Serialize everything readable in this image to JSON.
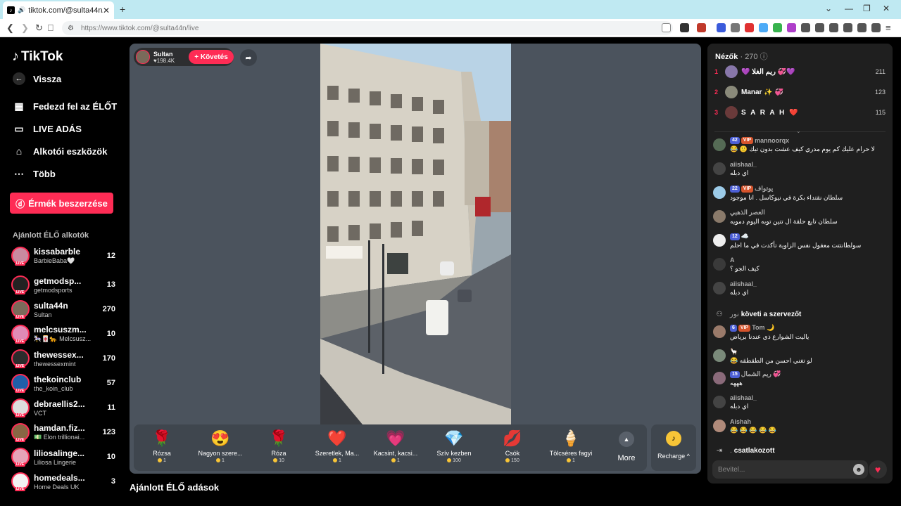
{
  "browser": {
    "tab_title": "tiktok.com/@sulta44n/live",
    "url": "https://www.tiktok.com/@sulta44n/live"
  },
  "sidebar": {
    "logo": "TikTok",
    "back": "Vissza",
    "nav": [
      {
        "label": "Fedezd fel az ÉLŐT",
        "icon": "calendar-live-icon"
      },
      {
        "label": "LIVE ADÁS",
        "icon": "camera-icon"
      },
      {
        "label": "Alkotói eszközök",
        "icon": "creator-tools-icon"
      },
      {
        "label": "Több",
        "icon": "more-dots-icon"
      }
    ],
    "coins_button": "Érmék beszerzése",
    "recommended_title": "Ajánlott ÉLŐ alkotók",
    "creators": [
      {
        "username": "kissabarble",
        "nickname": "BarbieBaba🤍",
        "count": "12"
      },
      {
        "username": "getmodsp...",
        "nickname": "getmodsports",
        "count": "13"
      },
      {
        "username": "sulta44n",
        "nickname": "Sultan",
        "count": "270"
      },
      {
        "username": "melcsuszm...",
        "nickname": "🎠🀄🐆 Melcsusz...",
        "count": "10"
      },
      {
        "username": "thewessex...",
        "nickname": "thewessexmint",
        "count": "170"
      },
      {
        "username": "thekoinclub",
        "nickname": "the_koin_club",
        "count": "57"
      },
      {
        "username": "debraellis2...",
        "nickname": "VCT",
        "count": "11"
      },
      {
        "username": "hamdan.fiz...",
        "nickname": "💵 Elon trillionai...",
        "count": "123"
      },
      {
        "username": "liliosalinge...",
        "nickname": "Liliosa Lingerie",
        "count": "10"
      },
      {
        "username": "homedeals...",
        "nickname": "Home Deals UK",
        "count": "3"
      }
    ]
  },
  "live": {
    "host_name": "Sultan",
    "host_likes": "198.4K",
    "follow_label": "+ Követés",
    "gifts": [
      {
        "name": "Rózsa",
        "price": "1",
        "icon": "🌹"
      },
      {
        "name": "Nagyon szere...",
        "price": "1",
        "icon": "😍"
      },
      {
        "name": "Róza",
        "price": "10",
        "icon": "🌹"
      },
      {
        "name": "Szeretlek, Ma...",
        "price": "1",
        "icon": "❤️"
      },
      {
        "name": "Kacsint, kacsi...",
        "price": "1",
        "icon": "💗"
      },
      {
        "name": "Szív kezben",
        "price": "100",
        "icon": "💎"
      },
      {
        "name": "Csók",
        "price": "150",
        "icon": "💋"
      },
      {
        "name": "Tölcséres fagyi",
        "price": "1",
        "icon": "🍦"
      }
    ],
    "more_label": "More",
    "recharge_label": "Recharge ^",
    "bottom_title": "Ajánlott ÉLŐ adások"
  },
  "chat": {
    "viewers_label": "Nézők",
    "viewers_count": "· 270",
    "top_viewers": [
      {
        "rank": "1",
        "name": "💜 ريم الغلا 💞💜",
        "score": "211"
      },
      {
        "rank": "2",
        "name": "Manar ✨ 💞",
        "score": "123"
      },
      {
        "rank": "3",
        "name": "S A R A H ❤️",
        "score": "115"
      }
    ],
    "messages": [
      {
        "user": "mannoorqx",
        "level": "42",
        "vip": "VIP",
        "text": "لا حرام عليك كم يوم مدري كيف عشت بدون تيك 🙂 😂"
      },
      {
        "user": "aiishaal_",
        "level": "",
        "vip": "",
        "text": "اي دبله"
      },
      {
        "user": "يوتواف",
        "level": "22",
        "vip": "VIP",
        "text": "سلطان نقتداء بكرة في نيوكاسل . انا موجود"
      },
      {
        "user": "العصر الذهبي",
        "level": "",
        "vip": "",
        "text": "سلطان تابع حلقة ال تتين توبه اليوم دمويه"
      },
      {
        "user": "☁️",
        "level": "12",
        "vip": "",
        "text": "سولطانتتت معقول نفس الزاوية تأكدت في ما احلم"
      },
      {
        "user": "A",
        "level": "",
        "vip": "",
        "text": "كيف الجو ؟"
      },
      {
        "user": "aiishaal_",
        "level": "",
        "vip": "",
        "text": "اي دبله"
      }
    ],
    "system_follow": {
      "name": "نور",
      "text": "követi a szervezőt"
    },
    "messages2": [
      {
        "user": "Tom 🌙",
        "level": "6",
        "vip": "VIP",
        "text": "ياليت الشوارع ذي عندنا برياض"
      },
      {
        "user": "🦙",
        "level": "",
        "vip": "",
        "text": "لو تغني احسن من الطقطقه 😂"
      },
      {
        "user": "ريم الشمال 💞",
        "level": "15",
        "vip": "",
        "text": "هههه"
      },
      {
        "user": "aiishaal_",
        "level": "",
        "vip": "",
        "text": "اي دبله"
      },
      {
        "user": "Aishah",
        "level": "",
        "vip": "",
        "text": "😂 😂 😂 😂 😂"
      }
    ],
    "system_join": {
      "name": ".",
      "text": "csatlakozott"
    },
    "input_placeholder": "Bevitel..."
  }
}
